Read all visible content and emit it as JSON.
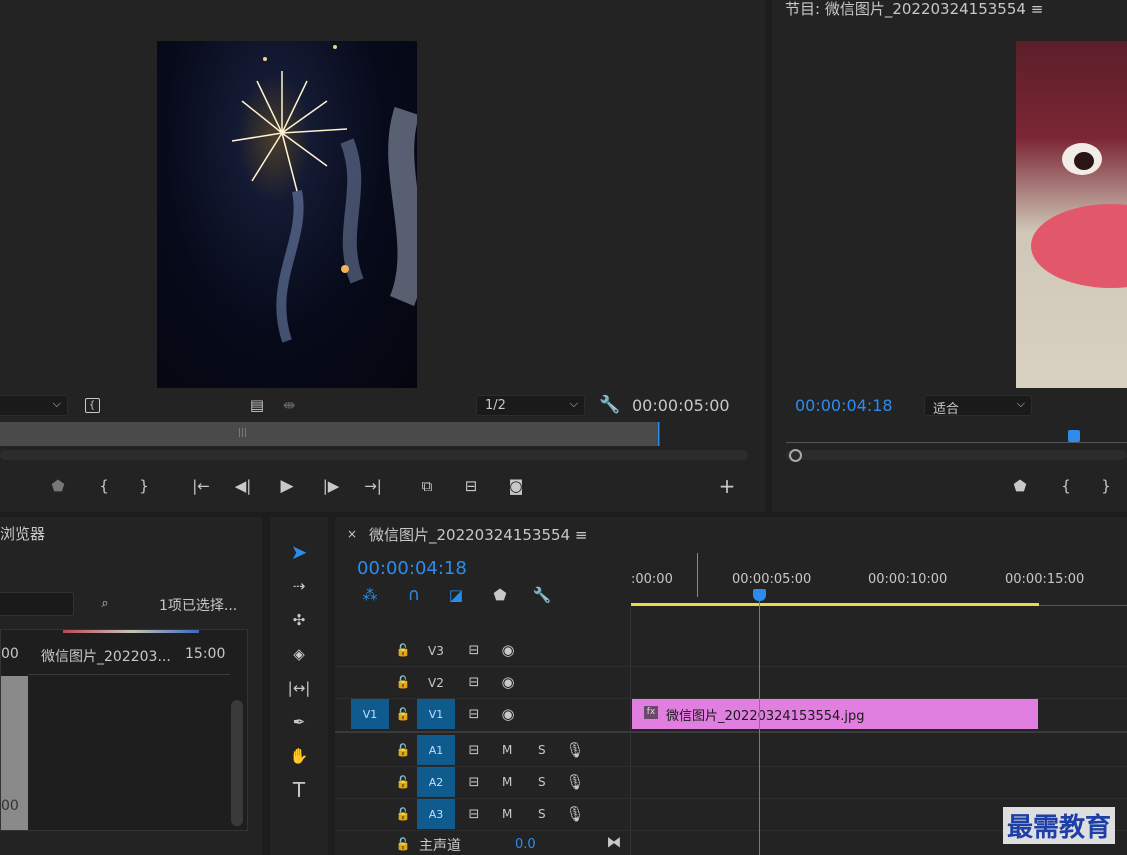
{
  "source_monitor": {
    "res_value": "1/2",
    "timecode": "00:00:05:00"
  },
  "program_monitor": {
    "title": "节目: 微信图片_20220324153554",
    "timecode": "00:00:04:18",
    "zoom_value": "适合"
  },
  "project": {
    "title": "浏览器",
    "selection_info": "1项已选择...",
    "item_name": "微信图片_202203...",
    "item_duration": "15:00",
    "col_left_top": "00",
    "col_left_bottom": "00"
  },
  "timeline": {
    "close_glyph": "×",
    "sequence_name": "微信图片_20220324153554",
    "timecode": "00:00:04:18",
    "ruler": [
      ":00:00",
      "00:00:05:00",
      "00:00:10:00",
      "00:00:15:00"
    ],
    "tracks_video": [
      "V3",
      "V2",
      "V1"
    ],
    "source_patch_v": "V1",
    "tracks_audio": [
      "A1",
      "A2",
      "A3"
    ],
    "mute_label": "M",
    "solo_label": "S",
    "master_label": "主声道",
    "master_value": "0.0",
    "clip_name": "微信图片_20220324153554.jpg",
    "clip_fx": "fx",
    "playhead_fraction": 0.29
  },
  "watermark": "最需教育",
  "colors": {
    "accent_blue": "#2d8ceb",
    "clip_pink": "#e07fe0",
    "work_area_yellow": "#e8d84a",
    "track_blue": "#0f5b8e"
  }
}
